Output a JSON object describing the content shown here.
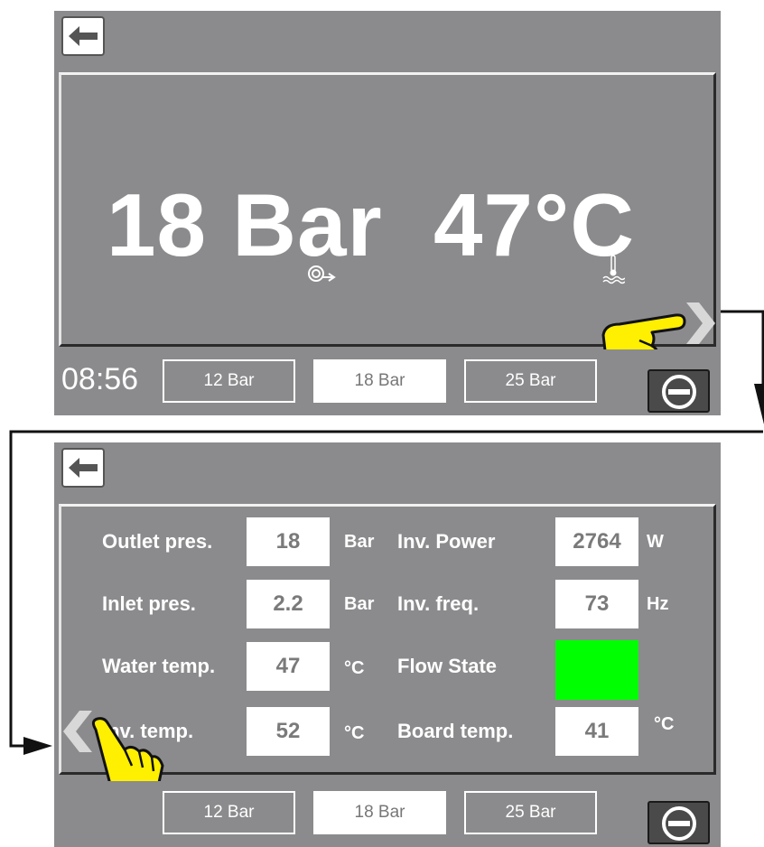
{
  "screen1": {
    "pressure_display": "18 Bar",
    "temperature_display": "47°C",
    "time": "08:56",
    "presets": [
      "12 Bar",
      "18 Bar",
      "25 Bar"
    ],
    "selected_preset": "18 Bar",
    "icons": [
      "back-arrow-icon",
      "pump-icon",
      "water-temperature-icon",
      "chevron-right-icon",
      "stop-icon",
      "pointing-hand-icon"
    ]
  },
  "screen2": {
    "rows_left": [
      {
        "label": "Outlet pres.",
        "value": "18",
        "unit": "Bar"
      },
      {
        "label": "Inlet pres.",
        "value": "2.2",
        "unit": "Bar"
      },
      {
        "label": "Water temp.",
        "value": "47",
        "unit": "°C"
      },
      {
        "label": "Inv. temp.",
        "value": "52",
        "unit": "°C"
      }
    ],
    "rows_right": [
      {
        "label": "Inv. Power",
        "value": "2764",
        "unit": "W"
      },
      {
        "label": "Inv. freq.",
        "value": "73",
        "unit": "Hz"
      },
      {
        "label": "Flow State",
        "value": "",
        "unit": ""
      },
      {
        "label": "Board temp.",
        "value": "41",
        "unit": "°C"
      }
    ],
    "flow_state_color": "#00ff00",
    "presets": [
      "12 Bar",
      "18 Bar",
      "25 Bar"
    ],
    "selected_preset": "18 Bar",
    "icons": [
      "back-arrow-icon",
      "chevron-left-icon",
      "stop-icon",
      "pointing-hand-icon"
    ]
  }
}
